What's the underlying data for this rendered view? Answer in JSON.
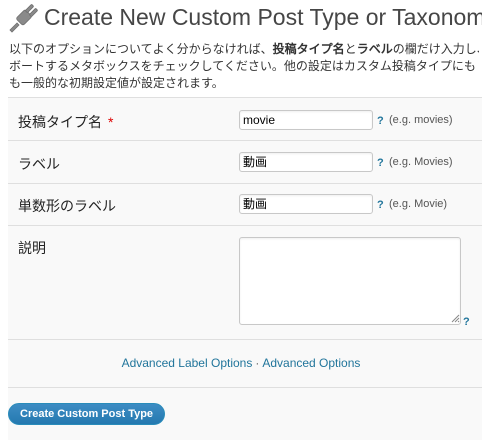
{
  "header": {
    "title": "Create New Custom Post Type or Taxonomy"
  },
  "intro": {
    "line1_a": "以下のオプションについてよく分からなければ、",
    "line1_b1": "投稿タイプ名",
    "line1_c": "と",
    "line1_b2": "ラベル",
    "line1_d": "の欄だけ入力し、",
    "line2": "ボートするメタボックスをチェックしてください。他の設定はカスタム投稿タイプにも",
    "line3": "も一般的な初期設定値が設定されます。"
  },
  "fields": {
    "post_type_name": {
      "label": "投稿タイプ名",
      "required_mark": "*",
      "value": "movie",
      "help": "?",
      "hint": "(e.g. movies)"
    },
    "label": {
      "label": "ラベル",
      "value": "動画",
      "help": "?",
      "hint": "(e.g. Movies)"
    },
    "singular_label": {
      "label": "単数形のラベル",
      "value": "動画",
      "help": "?",
      "hint": "(e.g. Movie)"
    },
    "description": {
      "label": "説明",
      "value": "",
      "help": "?"
    }
  },
  "links": {
    "advanced_label": "Advanced Label Options",
    "separator": "·",
    "advanced": "Advanced Options"
  },
  "submit": {
    "label": "Create Custom Post Type"
  },
  "colors": {
    "link": "#21759b",
    "required": "#dd0000",
    "button": "#2479b0"
  }
}
